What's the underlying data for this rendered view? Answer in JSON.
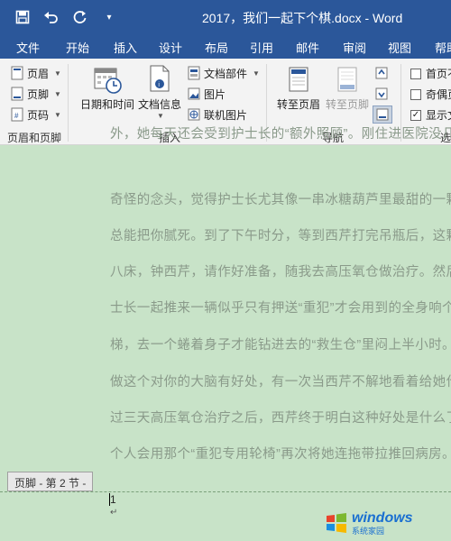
{
  "window": {
    "title": "2017，我们一起下个棋.docx - Word"
  },
  "qat": {
    "save": "save-icon",
    "undo": "undo-icon",
    "redo": "redo-icon",
    "customize": "▾"
  },
  "tabs": [
    "文件",
    "开始",
    "插入",
    "设计",
    "布局",
    "引用",
    "邮件",
    "审阅",
    "视图",
    "帮助"
  ],
  "ribbon": {
    "header_footer": {
      "header": "页眉",
      "footer": "页脚",
      "page_number": "页码",
      "group_label": "页眉和页脚"
    },
    "insert": {
      "date_time": "日期和时间",
      "doc_info": "文档信息",
      "quick_parts": "文档部件",
      "picture": "图片",
      "online_picture": "联机图片",
      "group_label": "插入"
    },
    "navigation": {
      "goto_header": "转至页眉",
      "goto_footer": "转至页脚",
      "group_label": "导航"
    },
    "options": {
      "first_page": "首页不",
      "odd_even": "奇偶页",
      "show_doc": "显示文",
      "group_label": "选"
    }
  },
  "document": {
    "lines": [
      "外，她每天还会受到护士长的“额外照顾”。刚住进医院没几",
      "奇怪的念头，觉得护士长尤其像一串冰糖葫芦里最甜的一颗",
      "总能把你腻死。到了下午时分，等到西芹打完吊瓶后，这颗糖",
      "八床，钟西芹，请作好准备，随我去高压氧仓做治疗。然后",
      "士长一起推来一辆似乎只有押送“重犯”才会用到的全身响个",
      "梯，去一个蜷着身子才能钻进去的“救生仓”里闷上半小时。",
      "做这个对你的大脑有好处，有一次当西芹不解地看着给她作",
      "过三天高压氧仓治疗之后，西芹终于明白这种好处是什么了",
      "个人会用那个“重犯专用轮椅”再次将她连拖带拉推回病房。"
    ],
    "footer_tag": "页脚 - 第 2 节 -",
    "page_number": "1",
    "paragraph_mark": "↵"
  },
  "watermark": {
    "main": "windows",
    "sub": "系统家园"
  }
}
